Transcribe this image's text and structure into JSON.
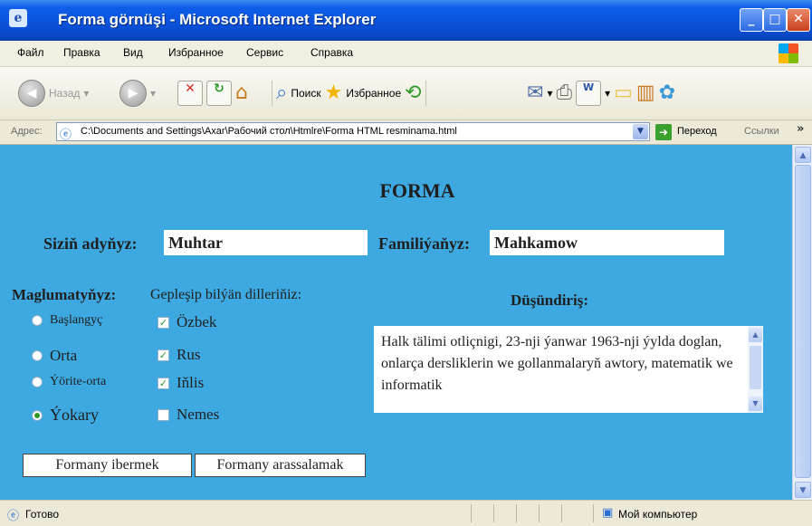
{
  "window": {
    "title": "Forma görnüşi - Microsoft Internet Explorer",
    "minimize": "_",
    "maximize": "□",
    "close": "✕"
  },
  "menu": [
    "Файл",
    "Правка",
    "Вид",
    "Избранное",
    "Сервис",
    "Справка"
  ],
  "toolbar": {
    "back_label": "Назад",
    "search_label": "Поиск",
    "favorites_label": "Избранное"
  },
  "address": {
    "label": "Адрес:",
    "url": "C:\\Documents and Settings\\Axar\\Рабочий стол\\Htmlre\\Forma HTML resminama.html",
    "go_label": "Переход",
    "links_label": "Ссылки",
    "more": "»"
  },
  "form": {
    "title": "FORMA",
    "first_name_label": "Siziň adyňyz:",
    "first_name_value": "Muhtar",
    "last_name_label": "Familiýaňyz:",
    "last_name_value": "Mahkamow",
    "education_label": "Maglumatyňyz:",
    "languages_label": "Gepleşip bilýän dilleriňiz:",
    "education_options": [
      {
        "label": "Başlangyç",
        "selected": false
      },
      {
        "label": "Orta",
        "selected": false
      },
      {
        "label": "Ýörite-orta",
        "selected": false
      },
      {
        "label": "Ýokary",
        "selected": true
      }
    ],
    "language_options": [
      {
        "label": "Özbek",
        "checked": true
      },
      {
        "label": "Rus",
        "checked": true
      },
      {
        "label": "Iňlis",
        "checked": true
      },
      {
        "label": "Nemes",
        "checked": false
      }
    ],
    "comment_label": "Düşündiriş:",
    "comment_text": "Halk tälimi otliçnigi, 23-nji ýanwar 1963-nji ýylda doglan, onlarça dersliklerin we gollanmalaryň awtory, matematik we informatik",
    "submit_label": "Formany ibermek",
    "reset_label": "Formany arassalamak"
  },
  "status": {
    "text": "Готово",
    "zone": "Мой компьютер"
  },
  "colors": {
    "page_background": "#3da9e0",
    "titlebar": "#0a4fd6",
    "radio_check_color": "#2f9a2a"
  }
}
